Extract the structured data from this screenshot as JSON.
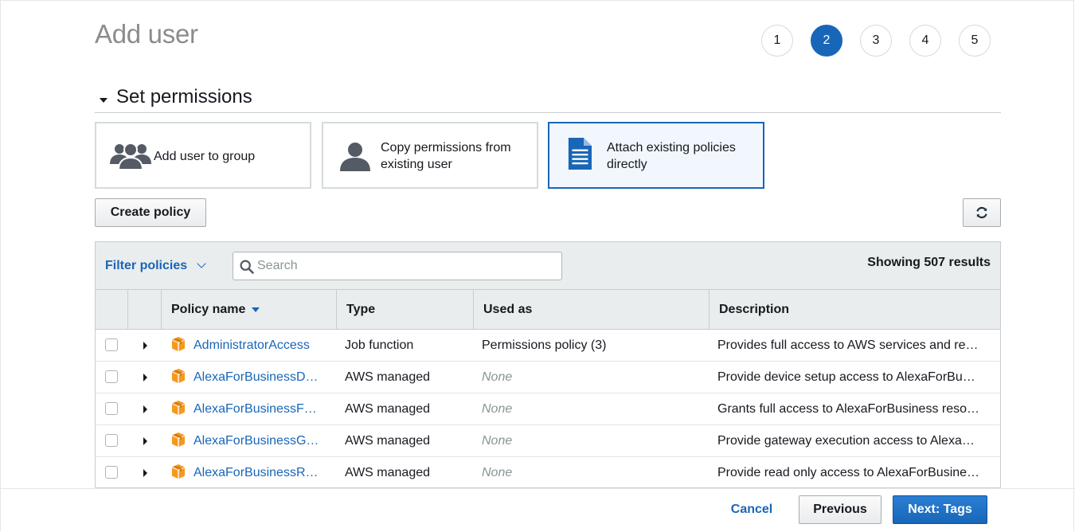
{
  "page": {
    "title": "Add user"
  },
  "steps": [
    "1",
    "2",
    "3",
    "4",
    "5"
  ],
  "active_step": "2",
  "section": {
    "title": "Set permissions"
  },
  "options": [
    {
      "label": "Add user to group",
      "icon": "users-group-icon",
      "selected": false
    },
    {
      "label": "Copy permissions from existing user",
      "icon": "user-icon",
      "selected": false
    },
    {
      "label": "Attach existing policies directly",
      "icon": "document-icon",
      "selected": true
    }
  ],
  "toolbar": {
    "create_policy_label": "Create policy",
    "refresh_icon": "refresh-icon"
  },
  "filter": {
    "label": "Filter policies",
    "search_placeholder": "Search",
    "search_value": "",
    "results_text": "Showing 507 results"
  },
  "table": {
    "columns": [
      "Policy name",
      "Type",
      "Used as",
      "Description"
    ],
    "rows": [
      {
        "name": "AdministratorAccess",
        "type": "Job function",
        "used_as": "Permissions policy (3)",
        "used_none": false,
        "description": "Provides full access to AWS services and re…"
      },
      {
        "name": "AlexaForBusinessD…",
        "type": "AWS managed",
        "used_as": "None",
        "used_none": true,
        "description": "Provide device setup access to AlexaForBu…"
      },
      {
        "name": "AlexaForBusinessF…",
        "type": "AWS managed",
        "used_as": "None",
        "used_none": true,
        "description": "Grants full access to AlexaForBusiness reso…"
      },
      {
        "name": "AlexaForBusinessG…",
        "type": "AWS managed",
        "used_as": "None",
        "used_none": true,
        "description": "Provide gateway execution access to Alexa…"
      },
      {
        "name": "AlexaForBusinessR…",
        "type": "AWS managed",
        "used_as": "None",
        "used_none": true,
        "description": "Provide read only access to AlexaForBusine…"
      }
    ]
  },
  "footer": {
    "cancel_label": "Cancel",
    "previous_label": "Previous",
    "next_label": "Next: Tags"
  },
  "colors": {
    "accent": "#1866b8",
    "selected_bg": "#f1f7fd",
    "policy_icon": "#f7981d",
    "muted": "#879596"
  }
}
